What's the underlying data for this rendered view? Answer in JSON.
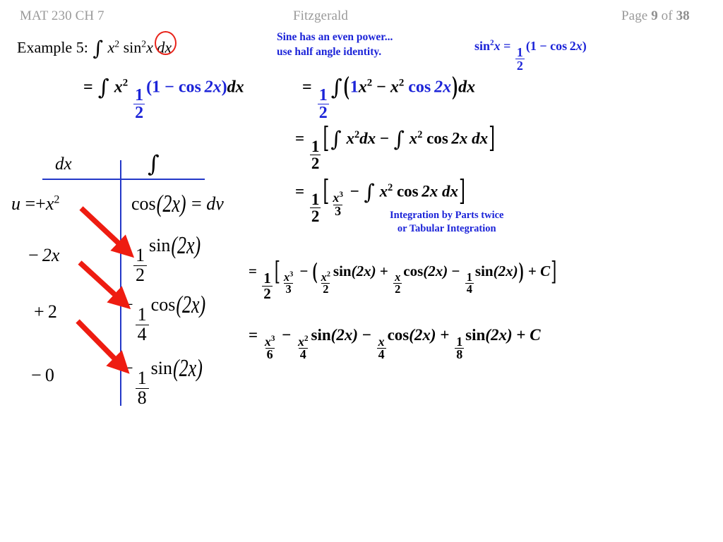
{
  "header": {
    "course": "MAT 230 CH 7",
    "author": "Fitzgerald",
    "page_prefix": "Page",
    "page_number": "9",
    "page_of": "of",
    "page_total": "38"
  },
  "example": {
    "label": "Example 5:",
    "integral_sym": "∫",
    "integrand_x": "x",
    "x_exponent": "2",
    "sin": "sin",
    "sin_exponent": "2",
    "var": "x",
    "differential": "dx",
    "circled_exponent": "2",
    "circle_color": "#e8231a"
  },
  "notes": {
    "even_power_line1": "Sine has an even power...",
    "even_power_line2": "use half angle identity.",
    "parts_line1": "Integration by Parts twice",
    "parts_line2": "or Tabular Integration",
    "note_color": "#1c24d8"
  },
  "identity": {
    "lhs_sin": "sin",
    "lhs_exp": "2",
    "lhs_var": "x",
    "equals": "=",
    "num": "1",
    "den": "2",
    "open_paren": "(",
    "one": "1",
    "minus": "−",
    "cos": "cos",
    "two": "2",
    "var": "x",
    "close_paren": ")"
  },
  "equations": {
    "eq1": {
      "equals": "=",
      "int": "∫",
      "x": "x",
      "x_exp": "2",
      "num": "1",
      "den": "2",
      "open": "(",
      "one": "1",
      "minus": "−",
      "cos": "cos",
      "two_x": "2x",
      "close": ")",
      "dx": "dx"
    },
    "eq1b": {
      "equals": "=",
      "num": "1",
      "den": "2",
      "int": "∫",
      "open": "(",
      "one": "1",
      "x": "x",
      "x_exp": "2",
      "minus": "−",
      "x2": "x",
      "x2_exp": "2",
      "cos": "cos",
      "two_x": "2x",
      "close": ")",
      "dx": "dx"
    },
    "eq2": {
      "equals": "=",
      "num": "1",
      "den": "2",
      "lbracket": "[",
      "int1": "∫",
      "x": "x",
      "x_exp": "2",
      "dx": "dx",
      "minus": "−",
      "int2": "∫",
      "x2": "x",
      "x2_exp": "2",
      "cos": "cos",
      "two_x": "2x",
      "dx2": "dx",
      "rbracket": "]"
    },
    "eq3": {
      "equals": "=",
      "num": "1",
      "den": "2",
      "lbracket": "[",
      "fnum_x": "x",
      "fnum_exp": "3",
      "fden": "3",
      "minus": "−",
      "int": "∫",
      "x2": "x",
      "x2_exp": "2",
      "cos": "cos",
      "two_x": "2x",
      "dx": "dx",
      "rbracket": "]"
    },
    "eq4": {
      "equals": "=",
      "num": "1",
      "den": "2",
      "lbracket": "[",
      "f1_num_x": "x",
      "f1_num_exp": "3",
      "f1_den": "3",
      "minus1": "−",
      "lparen": "(",
      "f2_num_x": "x",
      "f2_num_exp": "2",
      "f2_den": "2",
      "sin1": "sin",
      "arg1": "(2x)",
      "plus": "+",
      "f3_num": "x",
      "f3_den": "2",
      "cos1": "cos",
      "arg2": "(2x)",
      "minus2": "−",
      "f4_num": "1",
      "f4_den": "4",
      "sin2": "sin",
      "arg3": "(2x)",
      "rparen": ")",
      "plus_c": "+",
      "c": "C",
      "rbracket": "]"
    },
    "eq5": {
      "equals": "=",
      "f1_num_x": "x",
      "f1_num_exp": "3",
      "f1_den": "6",
      "minus1": "−",
      "f2_num_x": "x",
      "f2_num_exp": "2",
      "f2_den": "4",
      "sin1": "sin",
      "arg1": "(2x)",
      "minus2": "−",
      "f3_num": "x",
      "f3_den": "4",
      "cos1": "cos",
      "arg2": "(2x)",
      "plus": "+",
      "f4_num": "1",
      "f4_den": "8",
      "sin2": "sin",
      "arg3": "(2x)",
      "plus_c": "+",
      "c": "C"
    }
  },
  "tabular": {
    "line_color": "#2338c8",
    "arrow_color": "#ee1c11",
    "head_left": "dx",
    "head_right": "∫",
    "rows": [
      {
        "left_prefix": "u",
        "left_equals": "=",
        "left_sign": "+",
        "left_var": "x",
        "left_exp": "2",
        "right_fn": "cos",
        "right_arg": "(2x)",
        "right_equals": "=",
        "right_dv": "dv"
      },
      {
        "left_sign": "−",
        "left_value": "2x",
        "right_sign": "",
        "right_num": "1",
        "right_den": "2",
        "right_fn": "sin",
        "right_arg": "(2x)"
      },
      {
        "left_sign": "+",
        "left_value": "2",
        "right_sign": "−",
        "right_num": "1",
        "right_den": "4",
        "right_fn": "cos",
        "right_arg": "(2x)"
      },
      {
        "left_sign": "−",
        "left_value": "0",
        "right_sign": "−",
        "right_num": "1",
        "right_den": "8",
        "right_fn": "sin",
        "right_arg": "(2x)"
      }
    ]
  }
}
